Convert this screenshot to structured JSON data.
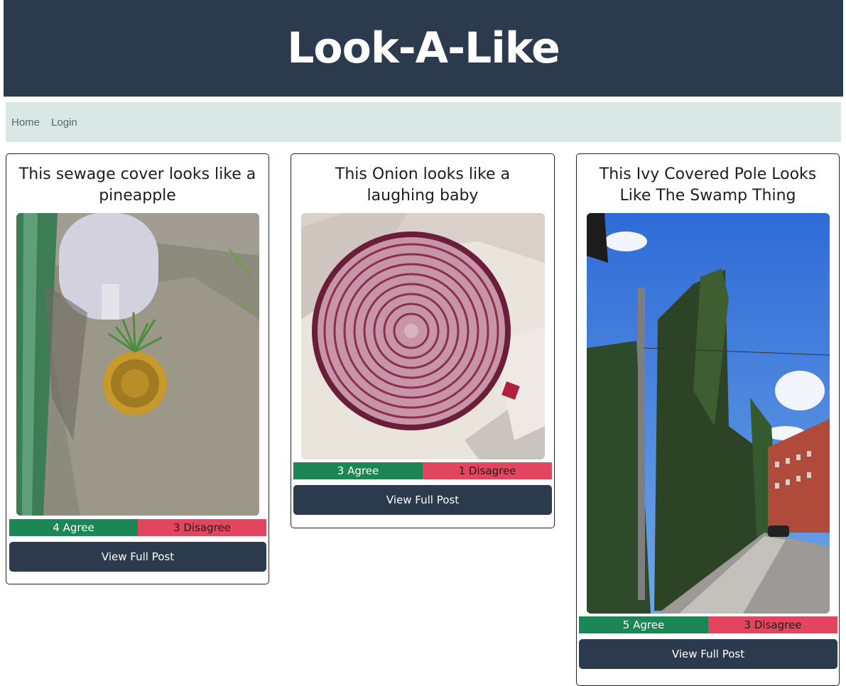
{
  "header": {
    "title": "Look-A-Like"
  },
  "nav": {
    "items": [
      {
        "label": "Home"
      },
      {
        "label": "Login"
      }
    ]
  },
  "posts": [
    {
      "title": "This sewage cover looks like a pineapple",
      "agree_label": "4 Agree",
      "disagree_label": "3 Disagree",
      "button_label": "View Full Post"
    },
    {
      "title": "This Onion looks like a laughing baby",
      "agree_label": "3 Agree",
      "disagree_label": "1 Disagree",
      "button_label": "View Full Post"
    },
    {
      "title": "This Ivy Covered Pole Looks Like The Swamp Thing",
      "agree_label": "5 Agree",
      "disagree_label": "3 Disagree",
      "button_label": "View Full Post"
    }
  ],
  "colors": {
    "header_bg": "#2c3a4e",
    "nav_bg": "#d9e7e5",
    "agree": "#1c8755",
    "disagree": "#e2465f"
  }
}
